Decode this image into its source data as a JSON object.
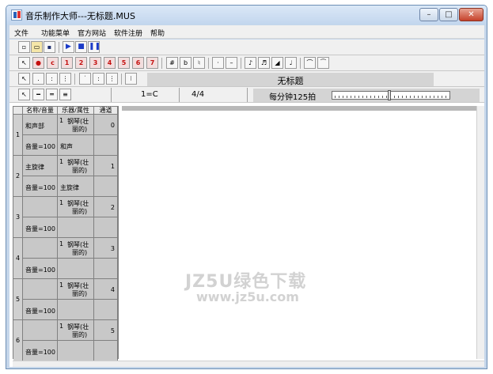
{
  "window": {
    "title": "音乐制作大师---无标题.MUS"
  },
  "menu": [
    "文件",
    "功能菜单",
    "官方网站",
    "软件注册",
    "帮助"
  ],
  "toolbar": {
    "red_notes": [
      "●",
      "c",
      "1",
      "2",
      "3",
      "4",
      "5",
      "6",
      "7"
    ],
    "accidentals": [
      "#",
      "b",
      "♮"
    ]
  },
  "song": {
    "title": "无标题"
  },
  "info": {
    "key": "1=C",
    "meter": "4/4",
    "tempo": "每分钟125拍",
    "tempo_level": 0.48
  },
  "tracks": {
    "headers": [
      "名称/音量",
      "乐器/属性",
      "通道"
    ],
    "rows": [
      {
        "index": "1",
        "name": "和声部",
        "volume": "音量=100",
        "instrument_no": "1",
        "instrument": "钢琴(壮",
        "instrument2": "丽的)",
        "attribute": "和声",
        "channel": "0"
      },
      {
        "index": "2",
        "name": "主旋律",
        "volume": "音量=100",
        "instrument_no": "1",
        "instrument": "钢琴(壮",
        "instrument2": "丽的)",
        "attribute": "主旋律",
        "channel": "1"
      },
      {
        "index": "3",
        "name": "",
        "volume": "音量=100",
        "instrument_no": "1",
        "instrument": "钢琴(壮",
        "instrument2": "丽的)",
        "attribute": "",
        "channel": "2"
      },
      {
        "index": "4",
        "name": "",
        "volume": "音量=100",
        "instrument_no": "1",
        "instrument": "钢琴(壮",
        "instrument2": "丽的)",
        "attribute": "",
        "channel": "3"
      },
      {
        "index": "5",
        "name": "",
        "volume": "音量=100",
        "instrument_no": "1",
        "instrument": "钢琴(壮",
        "instrument2": "丽的)",
        "attribute": "",
        "channel": "4"
      },
      {
        "index": "6",
        "name": "",
        "volume": "音量=100",
        "instrument_no": "1",
        "instrument": "钢琴(壮",
        "instrument2": "丽的)",
        "attribute": "",
        "channel": "5"
      }
    ]
  },
  "watermark": {
    "text": "JZ5U绿色下载",
    "url": "www.jz5u.com"
  }
}
